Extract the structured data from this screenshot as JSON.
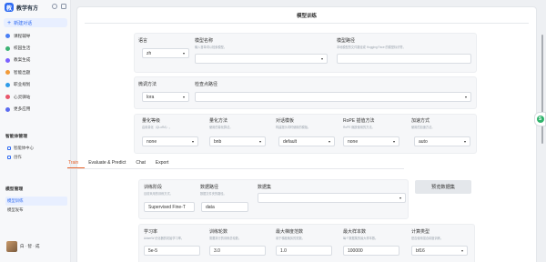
{
  "sidebar": {
    "brand": "教学有方",
    "logo_glyph": "教",
    "new_chat": "新建对话",
    "nav": [
      {
        "label": "课程辅导",
        "color": "#4a7ff5"
      },
      {
        "label": "校园生活",
        "color": "#3bb273"
      },
      {
        "label": "教案生成",
        "color": "#7b61ff"
      },
      {
        "label": "智能出题",
        "color": "#f29a38"
      },
      {
        "label": "职业规划",
        "color": "#2f9be8"
      },
      {
        "label": "心灵驿站",
        "color": "#e8566b"
      },
      {
        "label": "更多应用",
        "color": "#5b6bf0"
      }
    ],
    "section1": {
      "title": "智能体管理",
      "items": [
        "智能体中心",
        "创作"
      ]
    },
    "section2": {
      "title": "模型管理",
      "items": [
        "模型训练",
        "模型发布"
      ]
    },
    "user_name": "白 · 智 · 成"
  },
  "main": {
    "title": "模型训练",
    "lang": {
      "label": "语言",
      "value": "zh"
    },
    "model_name": {
      "label": "模型名称",
      "desc": "输入首单词以检索模型。",
      "value": ""
    },
    "model_path": {
      "label": "模型路径",
      "desc": "本地模型的文件路径或 Hugging Face 的模型标识符。",
      "value": ""
    },
    "finetune": {
      "label": "微调方法",
      "value": "lora"
    },
    "checkpoint": {
      "label": "检查点路径",
      "value": ""
    },
    "quant_bit": {
      "label": "量化等级",
      "desc": "启用量化（QLoRA）。",
      "value": "none"
    },
    "quant_method": {
      "label": "量化方法",
      "desc": "使用的量化算法。",
      "value": "bnb"
    },
    "template": {
      "label": "对话模板",
      "desc": "构建提示词时使用的模板。",
      "value": "default"
    },
    "rope": {
      "label": "RoPE 插值方法",
      "desc": "RoPE 缩放使用的方法。",
      "value": "none"
    },
    "booster": {
      "label": "加速方式",
      "desc": "使用的加速方法。",
      "value": "auto"
    },
    "tabs": [
      "Train",
      "Evaluate & Predict",
      "Chat",
      "Export"
    ],
    "stage": {
      "label": "训练阶段",
      "desc": "目前采用的训练方式。",
      "value": "Supervised Fine-T"
    },
    "data_dir": {
      "label": "数据路径",
      "desc": "数据文件夹的路径。",
      "value": "data"
    },
    "dataset": {
      "label": "数据集",
      "value": ""
    },
    "preview_btn": "预览数据集",
    "lr": {
      "label": "学习率",
      "desc": "AdamW 优化器的初始学习率。",
      "value": "5e-5"
    },
    "epochs": {
      "label": "训练轮数",
      "desc": "需要执行的训练总轮数。",
      "value": "3.0"
    },
    "max_grad": {
      "label": "最大梯度范数",
      "desc": "用于梯度裁剪的范数。",
      "value": "1.0"
    },
    "max_samples": {
      "label": "最大样本数",
      "desc": "每个数据集的最大样本数。",
      "value": "100000"
    },
    "compute_type": {
      "label": "计算类型",
      "desc": "是否使用混合精度训练。",
      "value": "bf16"
    }
  },
  "widget_glyph": "S"
}
